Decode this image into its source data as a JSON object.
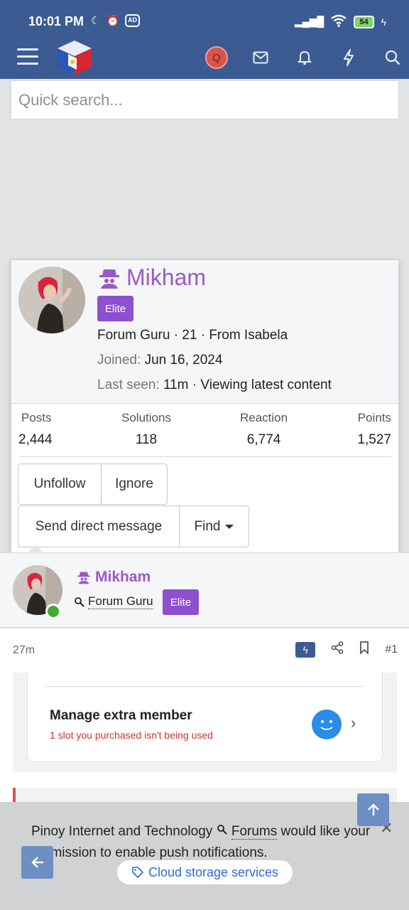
{
  "status_bar": {
    "time": "10:01 PM",
    "battery": "54",
    "ad_badge": "AD"
  },
  "header": {
    "icons": [
      "menu-icon",
      "site-logo",
      "user-avatar",
      "inbox-icon",
      "bell-icon",
      "bolt-icon",
      "search-icon"
    ],
    "avatar_letter": "Q",
    "colors": {
      "header_bg": "#3b5b92",
      "accent_purple": "#9b59c8",
      "badge_purple": "#8e4fd1",
      "avatar_red": "#d9534f"
    }
  },
  "search": {
    "placeholder": "Quick search..."
  },
  "profile_card": {
    "name": "Mikham",
    "badge": "Elite",
    "info_line": "Forum Guru · 21 · From Isabela",
    "joined_label": "Joined:",
    "joined_value": "Jun 16, 2024",
    "last_seen_label": "Last seen:",
    "last_seen_value": "11m · Viewing latest content",
    "stats": [
      {
        "label": "Posts",
        "value": "2,444"
      },
      {
        "label": "Solutions",
        "value": "118"
      },
      {
        "label": "Reaction",
        "value": "6,774"
      },
      {
        "label": "Points",
        "value": "1,527"
      }
    ],
    "buttons": {
      "unfollow": "Unfollow",
      "ignore": "Ignore",
      "message": "Send direct message",
      "find": "Find"
    }
  },
  "post": {
    "author": "Mikham",
    "user_title": "Forum Guru",
    "badge": "Elite",
    "age": "27m",
    "number": "#1"
  },
  "embedded": {
    "title": "Manage extra member",
    "subtitle": "1 slot you purchased isn't being used"
  },
  "push": {
    "text_part1": "Pinoy Internet and Technology",
    "text_link": "Forums",
    "text_part2": "would like your permission to enable push notifications.",
    "tag": "Cloud storage services"
  }
}
